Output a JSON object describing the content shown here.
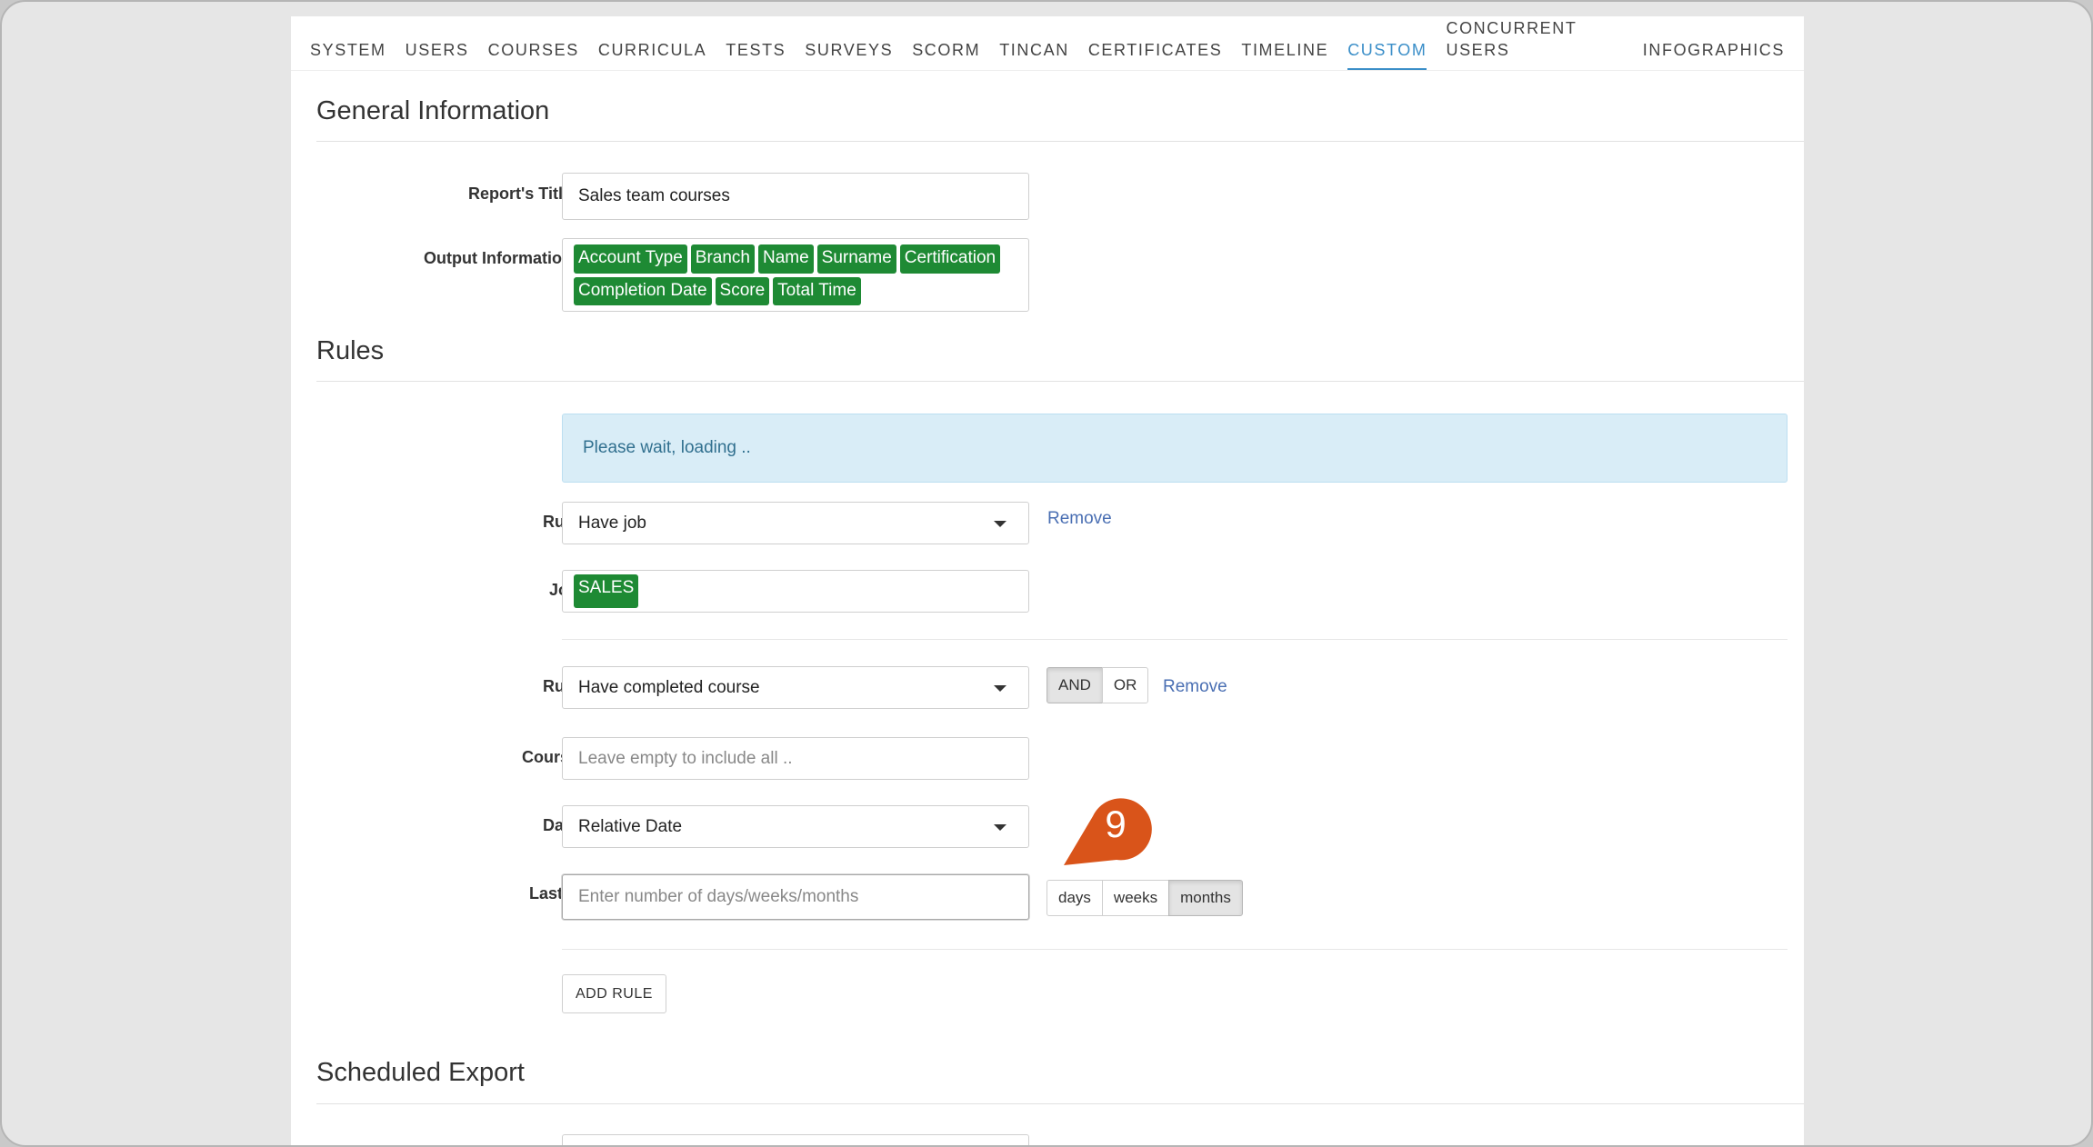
{
  "tabs": [
    "SYSTEM",
    "USERS",
    "COURSES",
    "CURRICULA",
    "TESTS",
    "SURVEYS",
    "SCORM",
    "TINCAN",
    "CERTIFICATES",
    "TIMELINE",
    "CUSTOM",
    "CONCURRENT USERS",
    "INFOGRAPHICS"
  ],
  "active_tab": "CUSTOM",
  "general": {
    "title": "General Information",
    "report_title_label": "Report's Title*",
    "report_title_value": "Sales team courses",
    "output_label": "Output Information*",
    "output_tags": [
      "Account Type",
      "Branch",
      "Name",
      "Surname",
      "Certification",
      "Completion Date",
      "Score",
      "Total Time"
    ]
  },
  "rules": {
    "title": "Rules",
    "loading_text": "Please wait, loading ..",
    "rule1": {
      "label": "Rule",
      "value": "Have job",
      "remove": "Remove",
      "job_label": "Job",
      "job_tag": "SALES"
    },
    "rule2": {
      "label": "Rule",
      "value": "Have completed course",
      "and_label": "AND",
      "or_label": "OR",
      "remove": "Remove",
      "course_label": "Course",
      "course_placeholder": "Leave empty to include all ..",
      "date_label": "Date",
      "date_value": "Relative Date",
      "lastx_label": "Last X",
      "lastx_placeholder": "Enter number of days/weeks/months",
      "units": [
        "days",
        "weeks",
        "months"
      ],
      "active_unit": "months"
    },
    "add_rule": "ADD RULE"
  },
  "scheduled": {
    "title": "Scheduled Export"
  },
  "step_marker": {
    "number": "9",
    "color": "#d9541a"
  }
}
